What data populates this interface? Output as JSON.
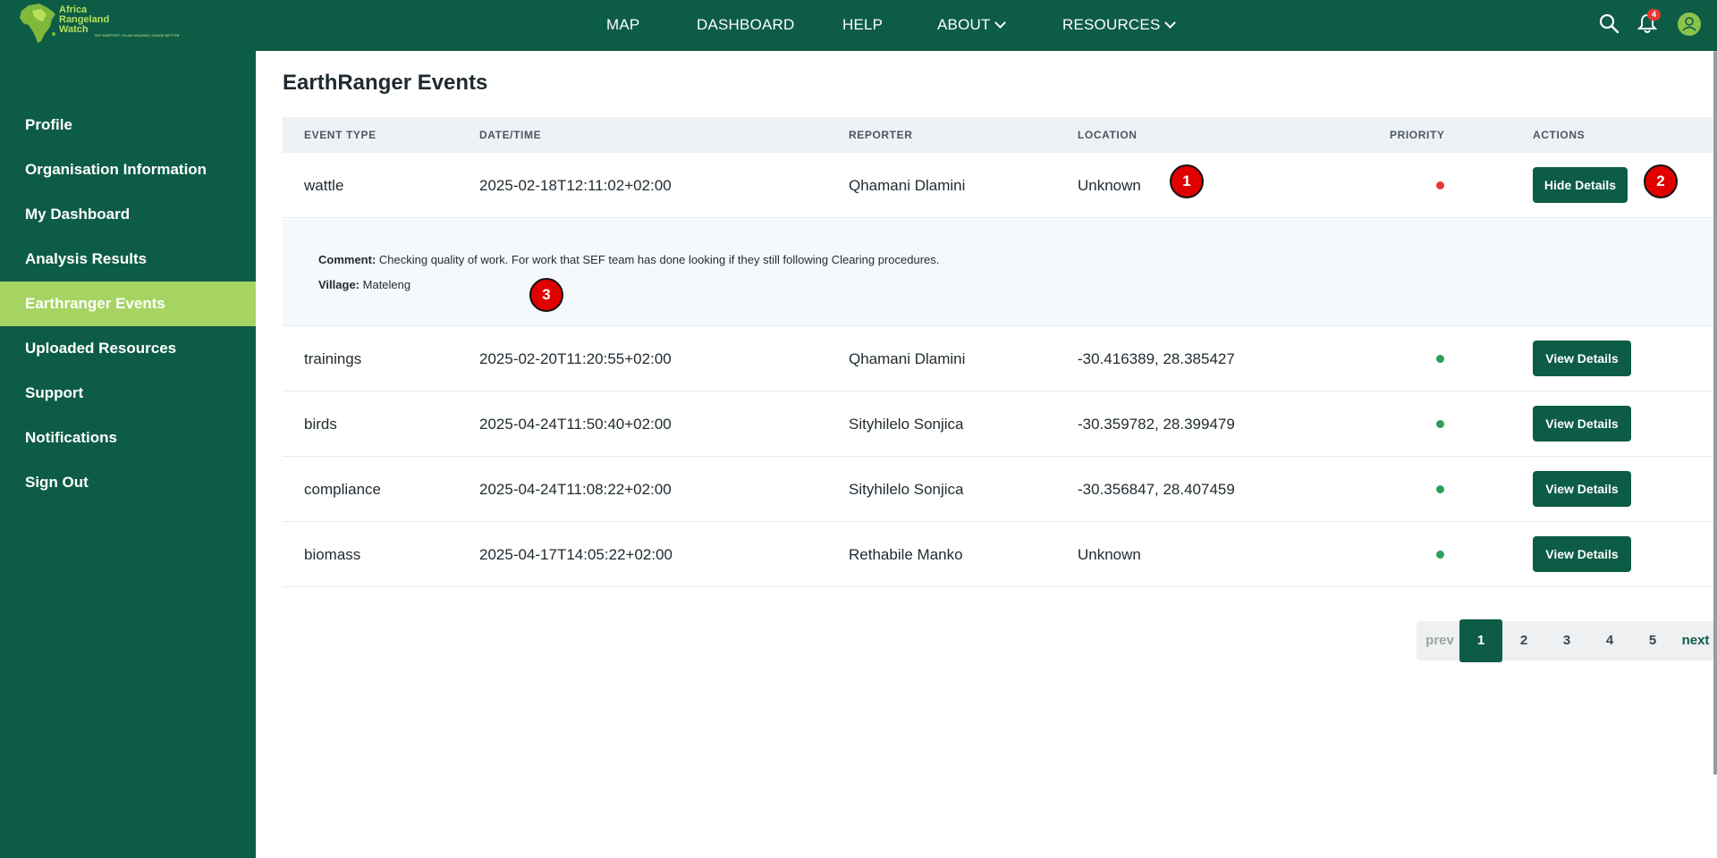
{
  "brand": {
    "name_line1": "Africa",
    "name_line2": "Rangeland",
    "name_line3": "Watch",
    "tagline": "SEF RAPPORT / PLAN GRAZING, RANGE BETTER"
  },
  "nav": {
    "items": [
      {
        "label": "MAP"
      },
      {
        "label": "DASHBOARD"
      },
      {
        "label": "HELP"
      },
      {
        "label": "ABOUT"
      },
      {
        "label": "RESOURCES"
      }
    ]
  },
  "header_icons": {
    "search": "search-icon",
    "bell": "bell-icon",
    "notification_count": "4",
    "user": "user-icon"
  },
  "sidebar": {
    "items": [
      {
        "label": "Profile"
      },
      {
        "label": "Organisation Information"
      },
      {
        "label": "My Dashboard"
      },
      {
        "label": "Analysis Results"
      },
      {
        "label": "Earthranger Events"
      },
      {
        "label": "Uploaded Resources"
      },
      {
        "label": "Support"
      },
      {
        "label": "Notifications"
      },
      {
        "label": "Sign Out"
      }
    ],
    "active_index": 4
  },
  "page": {
    "title": "EarthRanger Events"
  },
  "table": {
    "columns": [
      "EVENT TYPE",
      "DATE/TIME",
      "REPORTER",
      "LOCATION",
      "PRIORITY",
      "ACTIONS"
    ],
    "rows": [
      {
        "event_type": "wattle",
        "datetime": "2025-02-18T12:11:02+02:00",
        "reporter": "Qhamani Dlamini",
        "location": "Unknown",
        "priority_color": "#e53935",
        "action": "Hide Details"
      },
      {
        "event_type": "trainings",
        "datetime": "2025-02-20T11:20:55+02:00",
        "reporter": "Qhamani Dlamini",
        "location": "-30.416389, 28.385427",
        "priority_color": "#2e9e5b",
        "action": "View Details"
      },
      {
        "event_type": "birds",
        "datetime": "2025-04-24T11:50:40+02:00",
        "reporter": "Sityhilelo Sonjica",
        "location": "-30.359782, 28.399479",
        "priority_color": "#2e9e5b",
        "action": "View Details"
      },
      {
        "event_type": "compliance",
        "datetime": "2025-04-24T11:08:22+02:00",
        "reporter": "Sityhilelo Sonjica",
        "location": "-30.356847, 28.407459",
        "priority_color": "#2e9e5b",
        "action": "View Details"
      },
      {
        "event_type": "biomass",
        "datetime": "2025-04-17T14:05:22+02:00",
        "reporter": "Rethabile Manko",
        "location": "Unknown",
        "priority_color": "#2e9e5b",
        "action": "View Details"
      }
    ],
    "expanded": {
      "comment_label": "Comment:",
      "comment": "Checking quality of work. For work that SEF team has done looking if they still following Clearing procedures.",
      "village_label": "Village:",
      "village": "Mateleng"
    }
  },
  "markers": [
    "1",
    "2",
    "3"
  ],
  "pagination": {
    "prev": "prev",
    "pages": [
      "1",
      "2",
      "3",
      "4",
      "5"
    ],
    "current": "1",
    "next": "next"
  },
  "colors": {
    "primary": "#0d5c46",
    "active_sidebar": "#a6d463",
    "priority_high": "#e53935",
    "priority_normal": "#2e9e5b"
  }
}
